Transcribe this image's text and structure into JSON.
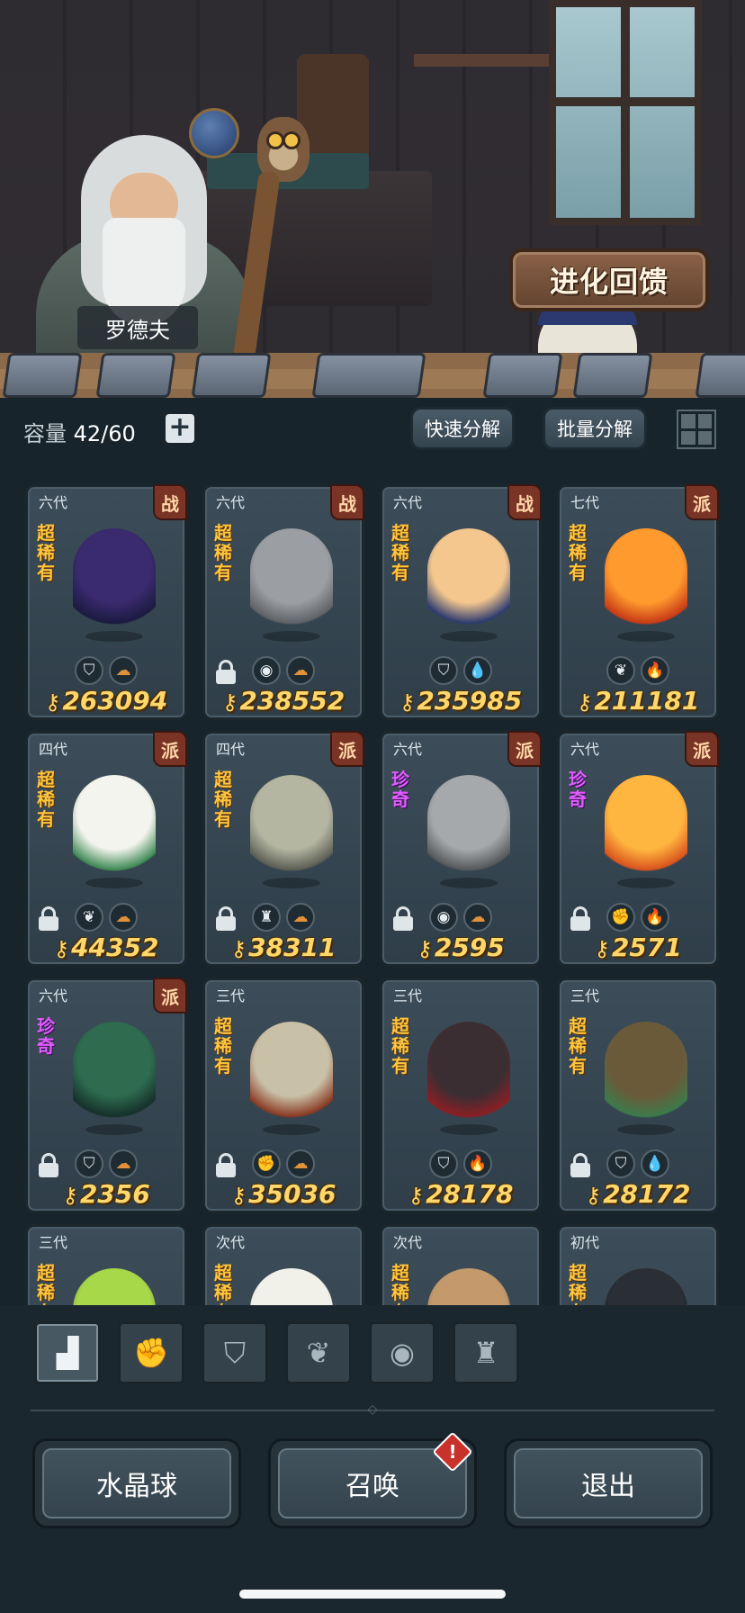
{
  "header": {
    "npc_name": "罗德夫",
    "evolution_button": "进化回馈"
  },
  "capacity": {
    "label": "容量",
    "value": "42/60",
    "add_icon": "plus-icon"
  },
  "actions": {
    "quick_decompose": "快速分解",
    "batch_decompose": "批量分解",
    "view_toggle_icon": "grid-view-icon"
  },
  "power_icon": "key-power-icon",
  "cards": [
    {
      "gen": "六代",
      "cls": "战",
      "rarity": "超稀有",
      "rare": false,
      "power": "263094",
      "locked": false,
      "icons": [
        "shield",
        "cloud"
      ],
      "sprite": [
        "#3a2a6e",
        "#1b1b40"
      ]
    },
    {
      "gen": "六代",
      "cls": "战",
      "rarity": "超稀有",
      "rare": false,
      "power": "238552",
      "locked": true,
      "icons": [
        "orb",
        "cloud"
      ],
      "sprite": [
        "#9b9ea2",
        "#5f6266"
      ]
    },
    {
      "gen": "六代",
      "cls": "战",
      "rarity": "超稀有",
      "rare": false,
      "power": "235985",
      "locked": false,
      "icons": [
        "shield",
        "drop"
      ],
      "sprite": [
        "#f3c78d",
        "#2c3a70"
      ]
    },
    {
      "gen": "七代",
      "cls": "派",
      "rarity": "超稀有",
      "rare": false,
      "power": "211181",
      "locked": false,
      "icons": [
        "leaf",
        "fire"
      ],
      "sprite": [
        "#ff9a2e",
        "#c73b16"
      ]
    },
    {
      "gen": "四代",
      "cls": "派",
      "rarity": "超稀有",
      "rare": false,
      "power": "44352",
      "locked": true,
      "icons": [
        "leaf",
        "cloud"
      ],
      "sprite": [
        "#f4f4ee",
        "#3f8a55"
      ]
    },
    {
      "gen": "四代",
      "cls": "派",
      "rarity": "超稀有",
      "rare": false,
      "power": "38311",
      "locked": true,
      "icons": [
        "tower",
        "cloud"
      ],
      "sprite": [
        "#b4b6a2",
        "#5d5f55"
      ]
    },
    {
      "gen": "六代",
      "cls": "派",
      "rarity": "珍奇",
      "rare": true,
      "power": "2595",
      "locked": true,
      "icons": [
        "orb",
        "cloud"
      ],
      "sprite": [
        "#a6a9ac",
        "#56595c"
      ]
    },
    {
      "gen": "六代",
      "cls": "派",
      "rarity": "珍奇",
      "rare": true,
      "power": "2571",
      "locked": true,
      "icons": [
        "fist",
        "fire"
      ],
      "sprite": [
        "#ffb640",
        "#d9541d"
      ]
    },
    {
      "gen": "六代",
      "cls": "派",
      "rarity": "珍奇",
      "rare": true,
      "power": "2356",
      "locked": true,
      "icons": [
        "shield",
        "cloud"
      ],
      "sprite": [
        "#2e6b4f",
        "#15302a"
      ]
    },
    {
      "gen": "三代",
      "cls": "",
      "rarity": "超稀有",
      "rare": false,
      "power": "35036",
      "locked": true,
      "icons": [
        "fist",
        "cloud"
      ],
      "sprite": [
        "#c9c1a7",
        "#8a3a24"
      ]
    },
    {
      "gen": "三代",
      "cls": "",
      "rarity": "超稀有",
      "rare": false,
      "power": "28178",
      "locked": false,
      "icons": [
        "shield",
        "fire"
      ],
      "sprite": [
        "#3a2e33",
        "#8b1f24"
      ]
    },
    {
      "gen": "三代",
      "cls": "",
      "rarity": "超稀有",
      "rare": false,
      "power": "28172",
      "locked": true,
      "icons": [
        "shield",
        "drop"
      ],
      "sprite": [
        "#6b5a3a",
        "#3c7a4a"
      ]
    },
    {
      "gen": "三代",
      "cls": "",
      "rarity": "超稀有",
      "rare": false,
      "power": "",
      "locked": false,
      "icons": [],
      "sprite": [
        "#a6d84a",
        "#6a5a40"
      ]
    },
    {
      "gen": "次代",
      "cls": "",
      "rarity": "超稀有",
      "rare": false,
      "power": "",
      "locked": false,
      "icons": [],
      "sprite": [
        "#f1f1ea",
        "#d8d8d0"
      ]
    },
    {
      "gen": "次代",
      "cls": "",
      "rarity": "超稀有",
      "rare": false,
      "power": "",
      "locked": false,
      "icons": [],
      "sprite": [
        "#c49a6c",
        "#7a5a3e"
      ]
    },
    {
      "gen": "初代",
      "cls": "",
      "rarity": "超稀有",
      "rare": false,
      "power": "",
      "locked": false,
      "icons": [],
      "sprite": [
        "#2a2f36",
        "#15181c"
      ]
    }
  ],
  "tabs": [
    {
      "icon": "all-blocks-icon",
      "active": true
    },
    {
      "icon": "fist-icon",
      "active": false
    },
    {
      "icon": "winged-shield-icon",
      "active": false
    },
    {
      "icon": "leaf-icon",
      "active": false
    },
    {
      "icon": "spirit-orb-icon",
      "active": false
    },
    {
      "icon": "tower-icon",
      "active": false
    }
  ],
  "footer": {
    "crystal_ball": "水晶球",
    "summon": "召唤",
    "summon_badge": "!",
    "exit": "退出"
  }
}
